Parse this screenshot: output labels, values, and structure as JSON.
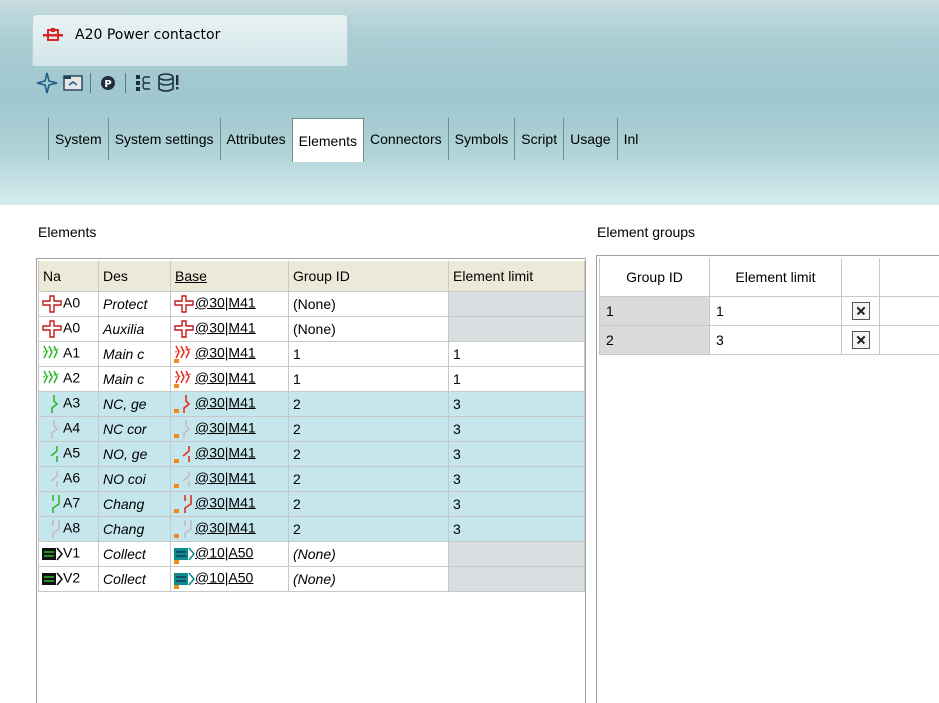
{
  "window": {
    "title": "A20  Power contactor",
    "icon": "contactor-red-icon"
  },
  "toolbar": {
    "items": [
      "star-navigate-icon",
      "folder-icon",
      "p-circle-icon",
      "list-icon",
      "database-alert-icon"
    ]
  },
  "tabs": [
    {
      "label": "System",
      "active": false
    },
    {
      "label": "System settings",
      "active": false
    },
    {
      "label": "Attributes",
      "active": false
    },
    {
      "label": "Elements",
      "active": true
    },
    {
      "label": "Connectors",
      "active": false
    },
    {
      "label": "Symbols",
      "active": false
    },
    {
      "label": "Script",
      "active": false
    },
    {
      "label": "Usage",
      "active": false
    },
    {
      "label": "Inl",
      "active": false
    }
  ],
  "elements_section": {
    "label": "Elements",
    "columns": [
      "Na",
      "Des",
      "Base",
      "Group ID",
      "Element limit"
    ],
    "rows": [
      {
        "icon": "protection-cross-icon",
        "name": "A0",
        "des": "Protect",
        "base_icon": "protection-cross-icon",
        "base": "@30|M41",
        "group_id": "(None)",
        "group_italic": false,
        "limit": "",
        "highlight": false
      },
      {
        "icon": "protection-cross-icon",
        "name": "A0",
        "des": "Auxilia",
        "base_icon": "protection-cross-icon",
        "base": "@30|M41",
        "group_id": "(None)",
        "group_italic": false,
        "limit": "",
        "highlight": false
      },
      {
        "icon": "main-contact-green-icon",
        "name": "A1",
        "des": "Main c",
        "base_icon": "main-contact-red-icon",
        "base": "@30|M41",
        "group_id": "1",
        "group_italic": false,
        "limit": "1",
        "highlight": false
      },
      {
        "icon": "main-contact-green-icon",
        "name": "A2",
        "des": "Main c",
        "base_icon": "main-contact-red-icon",
        "base": "@30|M41",
        "group_id": "1",
        "group_italic": false,
        "limit": "1",
        "highlight": false
      },
      {
        "icon": "nc-contact-green-icon",
        "name": "A3",
        "des": "NC, ge",
        "base_icon": "nc-contact-red-icon",
        "base": "@30|M41",
        "group_id": "2",
        "group_italic": false,
        "limit": "3",
        "highlight": true
      },
      {
        "icon": "nc-contact-faint-icon",
        "name": "A4",
        "des": "NC cor",
        "base_icon": "nc-contact-faint-icon",
        "base": "@30|M41",
        "group_id": "2",
        "group_italic": false,
        "limit": "3",
        "highlight": true
      },
      {
        "icon": "no-contact-green-icon",
        "name": "A5",
        "des": "NO, ge",
        "base_icon": "no-contact-red-icon",
        "base": "@30|M41",
        "group_id": "2",
        "group_italic": false,
        "limit": "3",
        "highlight": true
      },
      {
        "icon": "no-contact-faint-icon",
        "name": "A6",
        "des": "NO coi",
        "base_icon": "no-contact-faint-icon",
        "base": "@30|M41",
        "group_id": "2",
        "group_italic": false,
        "limit": "3",
        "highlight": true
      },
      {
        "icon": "changeover-green-icon",
        "name": "A7",
        "des": "Chang",
        "base_icon": "changeover-red-icon",
        "base": "@30|M41",
        "group_id": "2",
        "group_italic": false,
        "limit": "3",
        "highlight": true
      },
      {
        "icon": "changeover-faint-icon",
        "name": "A8",
        "des": "Chang",
        "base_icon": "changeover-faint-icon",
        "base": "@30|M41",
        "group_id": "2",
        "group_italic": false,
        "limit": "3",
        "highlight": true
      },
      {
        "icon": "collector-dark-icon",
        "name": "V1",
        "des": "Collect",
        "base_icon": "collector-teal-icon",
        "base": "@10|A50",
        "group_id": "(None)",
        "group_italic": true,
        "limit": "",
        "highlight": false
      },
      {
        "icon": "collector-dark-icon",
        "name": "V2",
        "des": "Collect",
        "base_icon": "collector-teal-icon",
        "base": "@10|A50",
        "group_id": "(None)",
        "group_italic": true,
        "limit": "",
        "highlight": false
      }
    ]
  },
  "groups_section": {
    "label": "Element groups",
    "columns": [
      "Group ID",
      "Element limit",
      ""
    ],
    "rows": [
      {
        "group_id": "1",
        "limit": "1"
      },
      {
        "group_id": "2",
        "limit": "3"
      }
    ]
  },
  "colors": {
    "accent_red": "#d9262b",
    "highlight_row": "#c4e6ec",
    "header_bg": "#ece9d8"
  }
}
